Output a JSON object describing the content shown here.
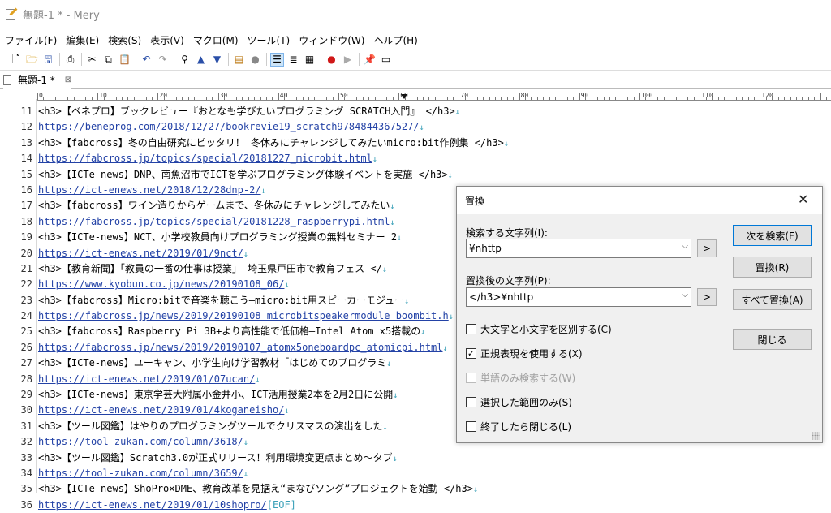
{
  "window": {
    "title": "無題-1 * - Mery"
  },
  "menu": [
    "ファイル(F)",
    "編集(E)",
    "検索(S)",
    "表示(V)",
    "マクロ(M)",
    "ツール(T)",
    "ウィンドウ(W)",
    "ヘルプ(H)"
  ],
  "tab": {
    "label": "無題-1 *",
    "close": "⊠"
  },
  "ruler": {
    "labels": [
      "0",
      "10",
      "20",
      "30",
      "40",
      "50",
      "60",
      "70",
      "80",
      "90",
      "100",
      "110",
      "120",
      "130"
    ]
  },
  "editor": {
    "lines": [
      {
        "n": "11",
        "text": "<h3>【ベネプロ】ブックレビュー『おとなも学びたいプログラミング SCRATCH入門』 </h3>",
        "url": false
      },
      {
        "n": "12",
        "text": "https://beneprog.com/2018/12/27/bookrevie19_scratch9784844367527/",
        "url": true
      },
      {
        "n": "13",
        "text": "<h3>【fabcross】冬の自由研究にピッタリ！ 冬休みにチャレンジしてみたいmicro:bit作例集 </h3>",
        "url": false
      },
      {
        "n": "14",
        "text": "https://fabcross.jp/topics/special/20181227_microbit.html",
        "url": true
      },
      {
        "n": "15",
        "text": "<h3>【ICTe-news】DNP、南魚沼市でICTを学ぶプログラミング体験イベントを実施 </h3>",
        "url": false
      },
      {
        "n": "16",
        "text": "https://ict-enews.net/2018/12/28dnp-2/",
        "url": true
      },
      {
        "n": "17",
        "text": "<h3>【fabcross】ワイン造りからゲームまで、冬休みにチャレンジしてみたい",
        "url": false
      },
      {
        "n": "18",
        "text": "https://fabcross.jp/topics/special/20181228_raspberrypi.html",
        "url": true
      },
      {
        "n": "19",
        "text": "<h3>【ICTe-news】NCT、小学校教員向けプログラミング授業の無料セミナー 2",
        "url": false
      },
      {
        "n": "20",
        "text": "https://ict-enews.net/2019/01/9nct/",
        "url": true
      },
      {
        "n": "21",
        "text": "<h3>【教育新聞】「教員の一番の仕事は授業」 埼玉県戸田市で教育フェス </",
        "url": false
      },
      {
        "n": "22",
        "text": "https://www.kyobun.co.jp/news/20190108_06/",
        "url": true
      },
      {
        "n": "23",
        "text": "<h3>【fabcross】Micro:bitで音楽を聴こう―micro:bit用スピーカーモジュー",
        "url": false
      },
      {
        "n": "24",
        "text": "https://fabcross.jp/news/2019/20190108_microbitspeakermodule_boombit.h",
        "url": true
      },
      {
        "n": "25",
        "text": "<h3>【fabcross】Raspberry Pi 3B+より高性能で低価格―Intel Atom x5搭載の",
        "url": false
      },
      {
        "n": "26",
        "text": "https://fabcross.jp/news/2019/20190107_atomx5oneboardpc_atomicpi.html",
        "url": true
      },
      {
        "n": "27",
        "text": "<h3>【ICTe-news】ユーキャン、小学生向け学習教材「はじめてのプログラミ",
        "url": false
      },
      {
        "n": "28",
        "text": "https://ict-enews.net/2019/01/07ucan/",
        "url": true
      },
      {
        "n": "29",
        "text": "<h3>【ICTe-news】東京学芸大附属小金井小、ICT活用授業2本を2月2日に公開",
        "url": false
      },
      {
        "n": "30",
        "text": "https://ict-enews.net/2019/01/4koganeisho/",
        "url": true
      },
      {
        "n": "31",
        "text": "<h3>【ツール図鑑】はやりのプログラミングツールでクリスマスの演出をした",
        "url": false
      },
      {
        "n": "32",
        "text": "https://tool-zukan.com/column/3618/",
        "url": true
      },
      {
        "n": "33",
        "text": "<h3>【ツール図鑑】Scratch3.0が正式リリース！利用環境変更点まとめ～タブ",
        "url": false
      },
      {
        "n": "34",
        "text": "https://tool-zukan.com/column/3659/",
        "url": true
      },
      {
        "n": "35",
        "text": "<h3>【ICTe-news】ShoPro×DME、教育改革を見据え“まなびソング”プロジェクトを始動 </h3>",
        "url": false
      },
      {
        "n": "36",
        "text": "https://ict-enews.net/2019/01/10shopro/",
        "url": true,
        "eof": "[EOF]"
      }
    ]
  },
  "dialog": {
    "title": "置換",
    "close": "✕",
    "find_label": "検索する文字列(I):",
    "find_value": "¥nhttp",
    "replace_label": "置換後の文字列(P):",
    "replace_value": "</h3>¥nhttp",
    "arrow_btn": ">",
    "buttons": {
      "find_next": "次を検索(F)",
      "replace": "置換(R)",
      "replace_all": "すべて置換(A)",
      "close": "閉じる"
    },
    "options": {
      "match_case": {
        "label": "大文字と小文字を区別する(C)",
        "checked": false
      },
      "regex": {
        "label": "正規表現を使用する(X)",
        "checked": true
      },
      "whole_word": {
        "label": "単語のみ検索する(W)",
        "checked": false
      },
      "selection_only": {
        "label": "選択した範囲のみ(S)",
        "checked": false
      },
      "close_when_done": {
        "label": "終了したら閉じる(L)",
        "checked": false
      }
    }
  }
}
